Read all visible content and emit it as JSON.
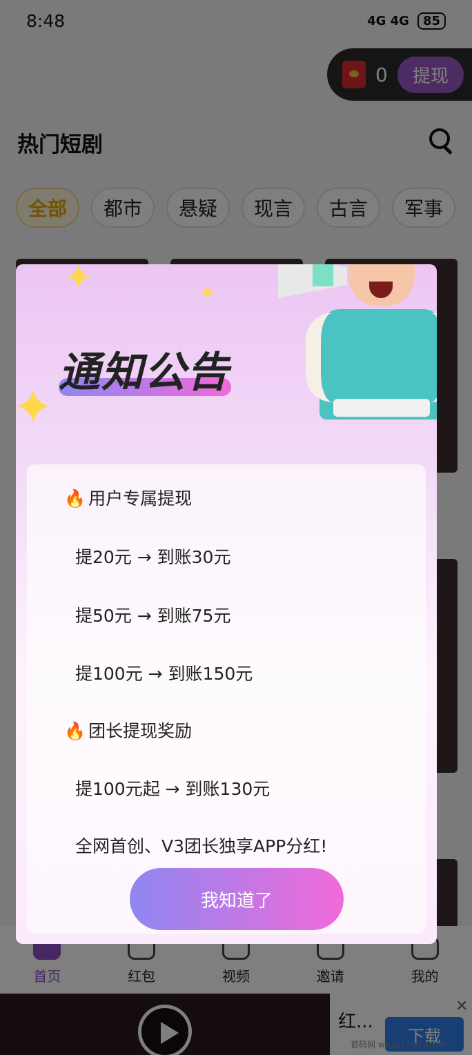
{
  "status_bar": {
    "time": "8:48",
    "network": "4G 4G",
    "battery": "85"
  },
  "wallet": {
    "amount": "0",
    "withdraw_label": "提现"
  },
  "header": {
    "title": "热门短剧"
  },
  "categories": [
    "全部",
    "都市",
    "悬疑",
    "现言",
    "古言",
    "军事"
  ],
  "dialog": {
    "title": "通知公告",
    "lines": [
      "用户专属提现",
      "提20元 → 到账30元",
      "提50元 → 到账75元",
      "提100元 → 到账150元",
      "团长提现奖励",
      "提100元起 → 到账130元",
      "全网首创、V3团长独享APP分红!"
    ],
    "confirm_label": "我知道了"
  },
  "bottom_nav": [
    "首页",
    "红包",
    "视频",
    "邀请",
    "我的"
  ],
  "ad": {
    "title": "红...",
    "download_label": "下载"
  },
  "watermark": "首码网 www.77smw.com"
}
